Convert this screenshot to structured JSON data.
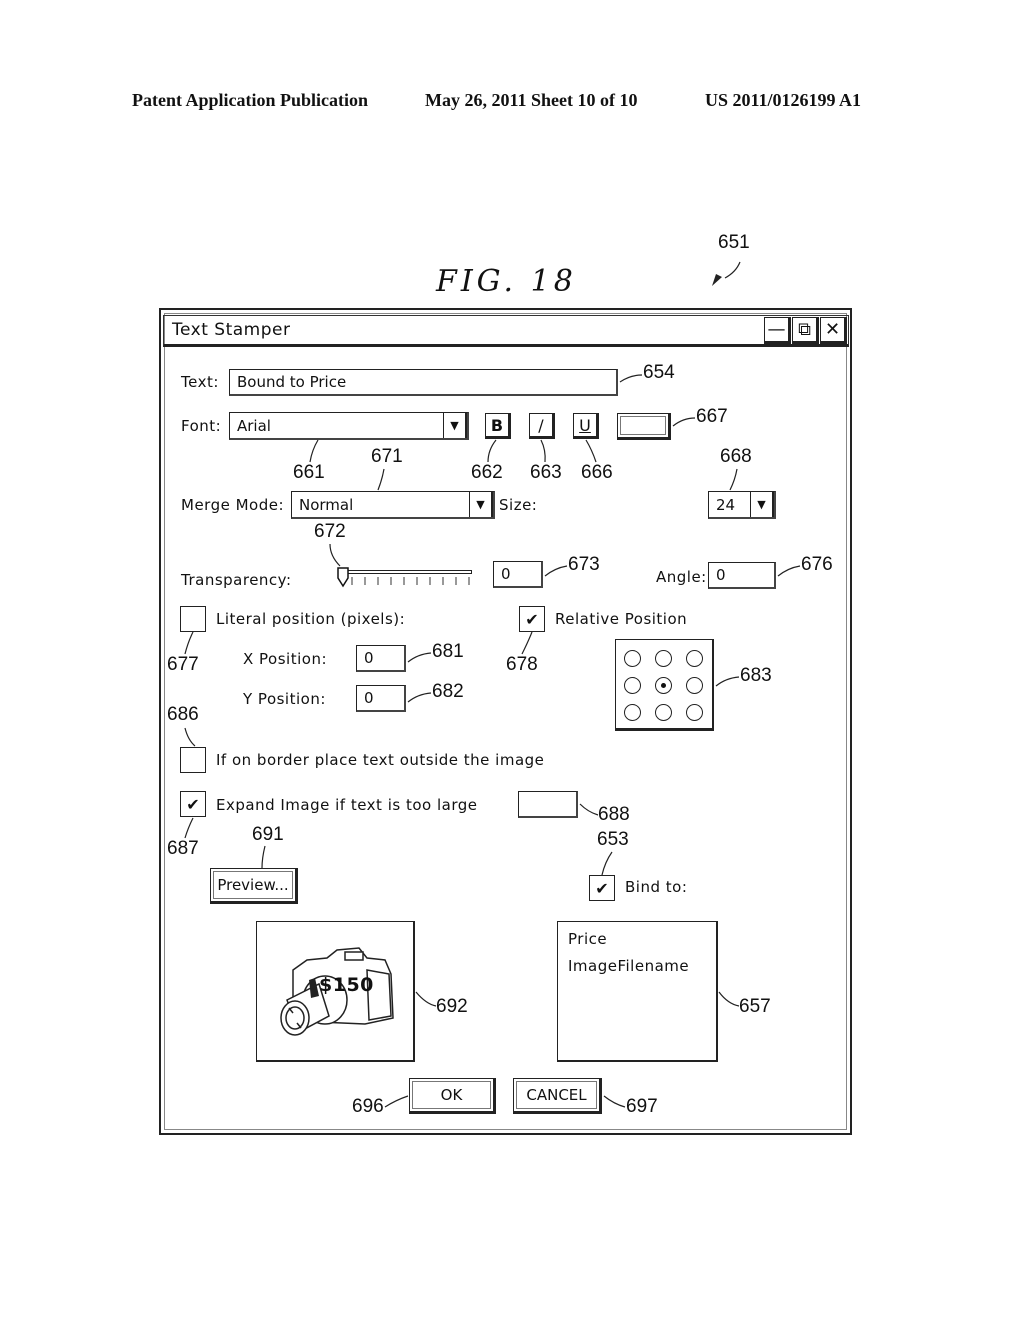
{
  "header": {
    "left": "Patent Application Publication",
    "middle": "May 26, 2011  Sheet 10 of 10",
    "right": "US 2011/0126199 A1"
  },
  "figure": {
    "label": "FIG. 18",
    "ref_window": "651"
  },
  "window": {
    "title": "Text Stamper",
    "controls": {
      "minimize": "—",
      "restore": "⧉",
      "close": "✕"
    }
  },
  "form": {
    "text_label": "Text:",
    "text_value": "Bound to Price",
    "font_label": "Font:",
    "font_value": "Arial",
    "bold": "B",
    "italic": "/",
    "underline": "U",
    "merge_mode_label": "Merge Mode:",
    "merge_mode_value": "Normal",
    "size_label": "Size:",
    "size_value": "24",
    "transparency_label": "Transparency:",
    "transparency_value": "0",
    "transparency_slider_fraction": 0,
    "angle_label": "Angle:",
    "angle_value": "0",
    "literal_position_label": "Literal position (pixels):",
    "literal_position_checked": false,
    "relative_position_label": "Relative Position",
    "relative_position_checked": true,
    "x_position_label": "X Position:",
    "x_position_value": "0",
    "y_position_label": "Y Position:",
    "y_position_value": "0",
    "relative_grid_selected": "center",
    "border_outside_label": "If on border place text outside the image",
    "border_outside_checked": false,
    "expand_image_label": "Expand Image if text is too large",
    "expand_image_checked": true,
    "preview_button": "Preview...",
    "bind_to_label": "Bind to:",
    "bind_to_checked": true,
    "bind_list": [
      "Price",
      "ImageFilename"
    ],
    "preview_overlay_text": "$150",
    "ok_button": "OK",
    "cancel_button": "CANCEL",
    "checkmark": "✔",
    "dropdown_arrow": "▼"
  },
  "refs": {
    "r654": "654",
    "r667": "667",
    "r661": "661",
    "r671": "671",
    "r662": "662",
    "r663": "663",
    "r666": "666",
    "r668": "668",
    "r672": "672",
    "r673": "673",
    "r676": "676",
    "r677": "677",
    "r678": "678",
    "r681": "681",
    "r682": "682",
    "r683": "683",
    "r686": "686",
    "r687": "687",
    "r688": "688",
    "r691": "691",
    "r653": "653",
    "r692": "692",
    "r657": "657",
    "r696": "696",
    "r697": "697"
  }
}
